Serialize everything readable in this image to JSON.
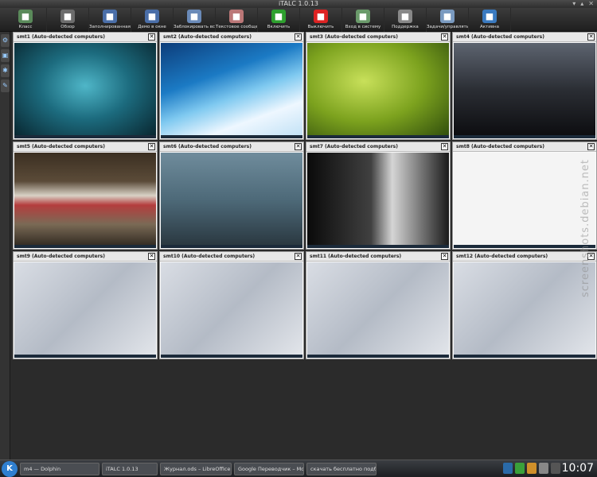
{
  "window": {
    "title": "iTALC 1.0.13"
  },
  "toolbar": {
    "buttons": [
      {
        "label": "Класс",
        "icon": "classroom-icon",
        "color": "#5a8a5a"
      },
      {
        "label": "Обзор",
        "icon": "binoculars-icon",
        "color": "#6c6c6c"
      },
      {
        "label": "Заполнированная Демо",
        "icon": "demo-fullscreen-icon",
        "color": "#4a6ea8"
      },
      {
        "label": "Демо в окне",
        "icon": "demo-window-icon",
        "color": "#4a6ea8"
      },
      {
        "label": "Заблокировать все",
        "icon": "lock-icon",
        "color": "#6a8ab8"
      },
      {
        "label": "Текстовое сообщение",
        "icon": "message-icon",
        "color": "#b77"
      },
      {
        "label": "Включить",
        "icon": "power-on-icon",
        "color": "#2ea02e"
      },
      {
        "label": "Выключить",
        "icon": "power-off-icon",
        "color": "#d22"
      },
      {
        "label": "Вход в систему",
        "icon": "login-icon",
        "color": "#6a9a6a"
      },
      {
        "label": "Поддержка",
        "icon": "support-icon",
        "color": "#888"
      },
      {
        "label": "Задачи/управлять",
        "icon": "magnifier-icon",
        "color": "#7a9ac0"
      },
      {
        "label": "Активна",
        "icon": "adjust-icon",
        "color": "#3a7ac0"
      }
    ]
  },
  "tiles": [
    {
      "name": "smt1 (Auto-detected computers)",
      "screen": "kde"
    },
    {
      "name": "smt2 (Auto-detected computers)",
      "screen": "wave"
    },
    {
      "name": "smt3 (Auto-detected computers)",
      "screen": "fly"
    },
    {
      "name": "smt4 (Auto-detected computers)",
      "screen": "city"
    },
    {
      "name": "smt5 (Auto-detected computers)",
      "screen": "train"
    },
    {
      "name": "smt6 (Auto-detected computers)",
      "screen": "tree"
    },
    {
      "name": "smt7 (Auto-detected computers)",
      "screen": "bw"
    },
    {
      "name": "smt8 (Auto-detected computers)",
      "screen": "white"
    },
    {
      "name": "smt9 (Auto-detected computers)",
      "screen": "grey"
    },
    {
      "name": "smt10 (Auto-detected computers)",
      "screen": "grey"
    },
    {
      "name": "smt11 (Auto-detected computers)",
      "screen": "grey"
    },
    {
      "name": "smt12 (Auto-detected computers)",
      "screen": "grey"
    }
  ],
  "close_glyph": "✕",
  "taskbar": {
    "tasks": [
      "m4 — Dolphin",
      "iTALC 1.0.13",
      "Журнал.ods – LibreOffice Calc",
      "Google Переводчик – Mozilla Firefox",
      "скачать бесплатно подборки"
    ],
    "clock": "10:07",
    "start_glyph": "K"
  },
  "watermark": "screenshots.debian.net"
}
